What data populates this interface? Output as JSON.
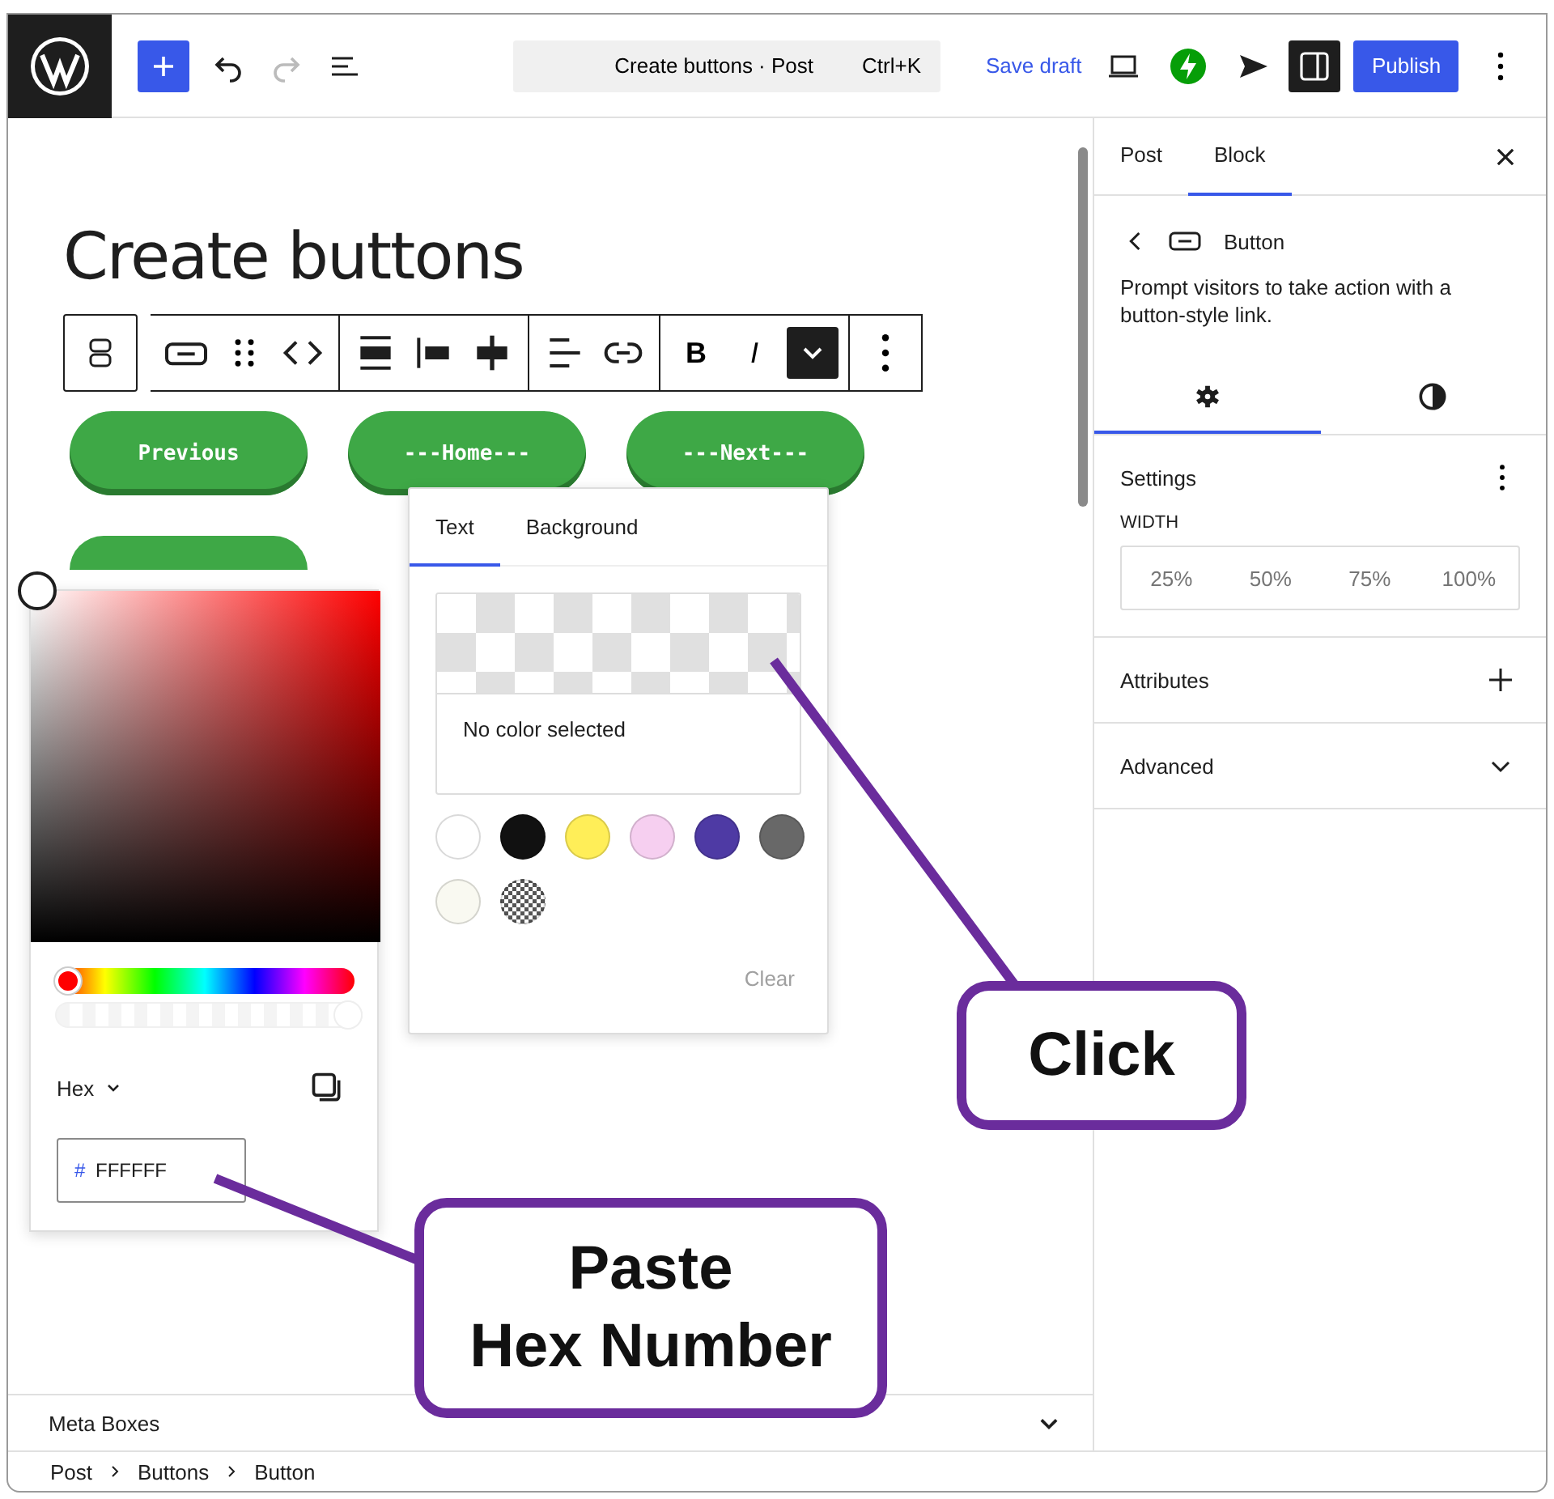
{
  "topbar": {
    "command": {
      "title": "Create buttons · Post",
      "shortcut": "Ctrl+K"
    },
    "save_draft": "Save draft",
    "publish": "Publish",
    "undo_disabled": false,
    "redo_disabled": true,
    "sidebar_toggle": {
      "selected": true
    }
  },
  "editor": {
    "title": "Create buttons",
    "toolbar": {
      "format": [
        {
          "label": "B",
          "kind": "bold"
        },
        {
          "label": "I",
          "kind": "italic"
        }
      ],
      "more_expanded": true
    },
    "buttons": [
      {
        "label": "Previous"
      },
      {
        "label": "---Home---"
      },
      {
        "label": "---Next---"
      },
      {
        "kind": "covered"
      }
    ]
  },
  "color_popover": {
    "tabs": [
      {
        "label": "Text",
        "selected": true
      },
      {
        "label": "Background",
        "selected": false
      }
    ],
    "preview": "No color selected",
    "swatches": [
      {
        "kind": "color",
        "color": "#ffffff"
      },
      {
        "kind": "color",
        "color": "#111111"
      },
      {
        "kind": "color",
        "color": "#ffee58"
      },
      {
        "kind": "color",
        "color": "#f6cff0"
      },
      {
        "kind": "color",
        "color": "#4e3aa4"
      },
      {
        "kind": "color",
        "color": "#686868"
      },
      {
        "kind": "color",
        "color": "#f9f9f1"
      },
      {
        "kind": "transparent"
      }
    ],
    "clear": "Clear"
  },
  "color_picker": {
    "hue": {
      "level": 0
    },
    "alpha": {
      "level": 1
    },
    "format": "Hex",
    "hex_prefix": "#",
    "hex_value": "FFFFFF"
  },
  "sidebar": {
    "tabs": [
      {
        "label": "Post",
        "selected": false
      },
      {
        "label": "Block",
        "selected": true
      }
    ],
    "block": {
      "name": "Button",
      "description": "Prompt visitors to take action with a button-style link."
    },
    "panel_tabs": [
      {
        "kind": "settings",
        "selected": true
      },
      {
        "kind": "styles",
        "selected": false
      }
    ],
    "settings": {
      "title": "Settings",
      "width_label": "WIDTH",
      "width_options": [
        {
          "label": "25%",
          "selected": false
        },
        {
          "label": "50%",
          "selected": false
        },
        {
          "label": "75%",
          "selected": false
        },
        {
          "label": "100%",
          "selected": false
        }
      ]
    },
    "sections": [
      {
        "title": "Attributes",
        "kind": "add"
      },
      {
        "title": "Advanced",
        "kind": "expand"
      }
    ]
  },
  "meta_boxes": {
    "title": "Meta Boxes"
  },
  "breadcrumb": [
    "Post",
    "Buttons",
    "Button"
  ],
  "callouts": [
    {
      "lines": [
        "Click"
      ]
    },
    {
      "lines": [
        "Paste",
        "Hex Number"
      ]
    }
  ]
}
